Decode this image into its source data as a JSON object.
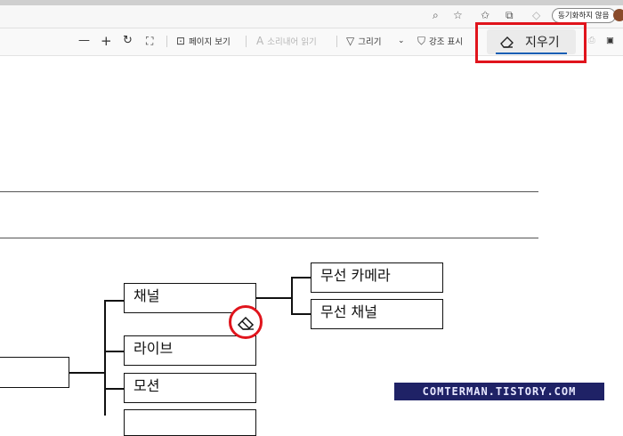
{
  "browser": {
    "sync_button": "동기화하지 않음"
  },
  "pdf_toolbar": {
    "zoom_out": "—",
    "zoom_in": "+",
    "page_view": "페이지 보기",
    "read_aloud": "소리내어 읽기",
    "draw": "그리기",
    "highlight": "강조 표시",
    "erase": "지우기"
  },
  "diagram": {
    "nodes": [
      "채널",
      "라이브",
      "모션"
    ],
    "subnodes": [
      "무선 카메라",
      "무선 채널"
    ]
  },
  "watermark": "COMTERMAN.TISTORY.COM",
  "colors": {
    "highlight_red": "#e0141c",
    "watermark_bg": "#1f2266",
    "active_underline": "#1a5fb4"
  }
}
